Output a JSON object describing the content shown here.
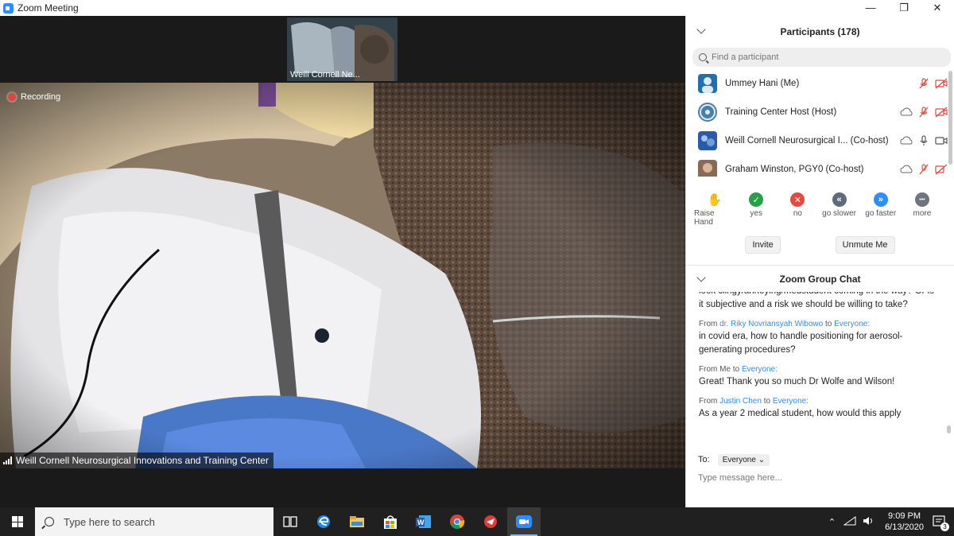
{
  "window": {
    "title": "Zoom Meeting",
    "controls": [
      "—",
      "❐",
      "✕"
    ]
  },
  "video": {
    "thumbnail_label": "Weill Cornell Ne...",
    "recording_label": "Recording",
    "speaker_label": "Weill Cornell Neurosurgical Innovations and Training Center"
  },
  "participants": {
    "title": "Participants (178)",
    "search_placeholder": "Find a participant",
    "list": [
      {
        "name": "Ummey Hani (Me)",
        "mic": "muted",
        "video": "off",
        "avatar_color": "#1f6fb2"
      },
      {
        "name": "Training Center Host (Host)",
        "mic": "muted",
        "video": "off",
        "avatar_color": "#4a7fa8"
      },
      {
        "name": "Weill Cornell Neurosurgical I... (Co-host)",
        "mic": "on",
        "video": "on",
        "avatar_color": "#2a5aa8"
      },
      {
        "name": "Graham Winston, PGY0 (Co-host)",
        "mic": "muted",
        "video": "off",
        "avatar_color": "#8a6a55"
      }
    ],
    "reactions": [
      {
        "label": "Raise Hand",
        "icon": "raise-hand-icon",
        "color": "#2d8cff",
        "glyph": "✋"
      },
      {
        "label": "yes",
        "icon": "yes-icon",
        "color": "#25a244",
        "glyph": "✓"
      },
      {
        "label": "no",
        "icon": "no-icon",
        "color": "#e5483f",
        "glyph": "✕"
      },
      {
        "label": "go slower",
        "icon": "go-slower-icon",
        "color": "#5f6a7a",
        "glyph": "«"
      },
      {
        "label": "go faster",
        "icon": "go-faster-icon",
        "color": "#2d8cff",
        "glyph": "»"
      },
      {
        "label": "more",
        "icon": "more-icon",
        "color": "#6d7580",
        "glyph": "•••"
      }
    ],
    "invite_label": "Invite",
    "unmute_label": "Unmute Me"
  },
  "chat": {
    "title": "Zoom Group Chat",
    "messages": [
      {
        "from": "",
        "to": "",
        "text": "look clingy/annoying/medstudent coming in the way? Or is it subjective and a risk we should be willing to take?"
      },
      {
        "from": "dr. Riky Novriansyah Wibowo",
        "to": "Everyone:",
        "text": "in covid era, how to handle positioning for aerosol-generating procedures?"
      },
      {
        "from": "Me",
        "to": "Everyone:",
        "text": "Great! Thank you so much Dr Wolfe and Wilson!"
      },
      {
        "from": "Justin Chen",
        "to": "Everyone:",
        "text": "As a year 2 medical student, how would this apply"
      }
    ],
    "from_word": "From",
    "to_word": "to",
    "to_label": "To:",
    "to_value": "Everyone",
    "input_placeholder": "Type message here..."
  },
  "taskbar": {
    "search_placeholder": "Type here to search",
    "apps": [
      "task-view-icon",
      "edge-icon",
      "file-explorer-icon",
      "store-icon",
      "word-icon",
      "chrome-icon",
      "app-icon",
      "zoom-icon"
    ],
    "time": "9:09 PM",
    "date": "6/13/2020",
    "notification_count": "3"
  }
}
